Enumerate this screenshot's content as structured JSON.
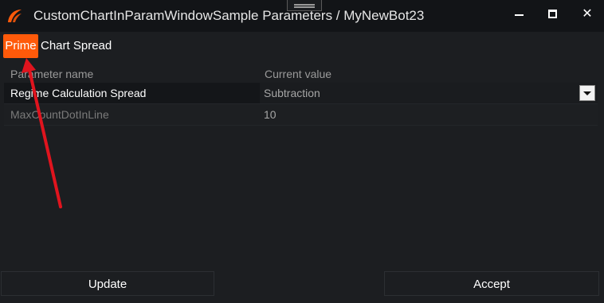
{
  "window": {
    "title": "CustomChartInParamWindowSample Parameters / MyNewBot23",
    "controls": {
      "minimize_icon": "minimize-icon",
      "maximize_icon": "maximize-icon",
      "close_icon": "close-icon",
      "close_glyph": "✕"
    }
  },
  "tabs": [
    {
      "label": "Prime",
      "active": true
    },
    {
      "label": "Chart Spread",
      "active": false
    }
  ],
  "grid": {
    "columns": [
      "Parameter name",
      "Current value"
    ],
    "rows": [
      {
        "name": "Regime Calculation Spread",
        "value": "Subtraction",
        "has_dropdown": true
      },
      {
        "name": "MaxCountDotInLine",
        "value": "10",
        "has_dropdown": false
      }
    ]
  },
  "buttons": {
    "update": "Update",
    "accept": "Accept"
  },
  "colors": {
    "accent": "#ff5a0a",
    "annotation_arrow": "#e0141e",
    "background": "#1c1e21",
    "titlebar": "#121417"
  }
}
